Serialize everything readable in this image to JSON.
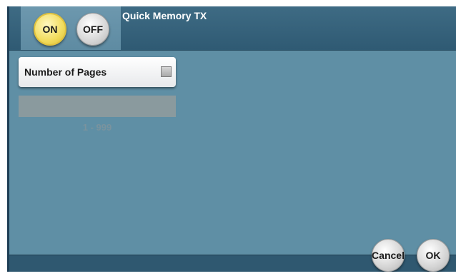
{
  "header": {
    "title": "Quick Memory TX",
    "on_label": "ON",
    "off_label": "OFF"
  },
  "pages": {
    "label": "Number of Pages",
    "value": "",
    "range": "1 - 999"
  },
  "footer": {
    "cancel_label": "Cancel",
    "ok_label": "OK"
  },
  "colors": {
    "background": "#5f8fa5",
    "header": "#3e6b84",
    "selected_toggle": "#f2dc5d"
  },
  "icons": {
    "checkbox": "checkbox-icon"
  }
}
